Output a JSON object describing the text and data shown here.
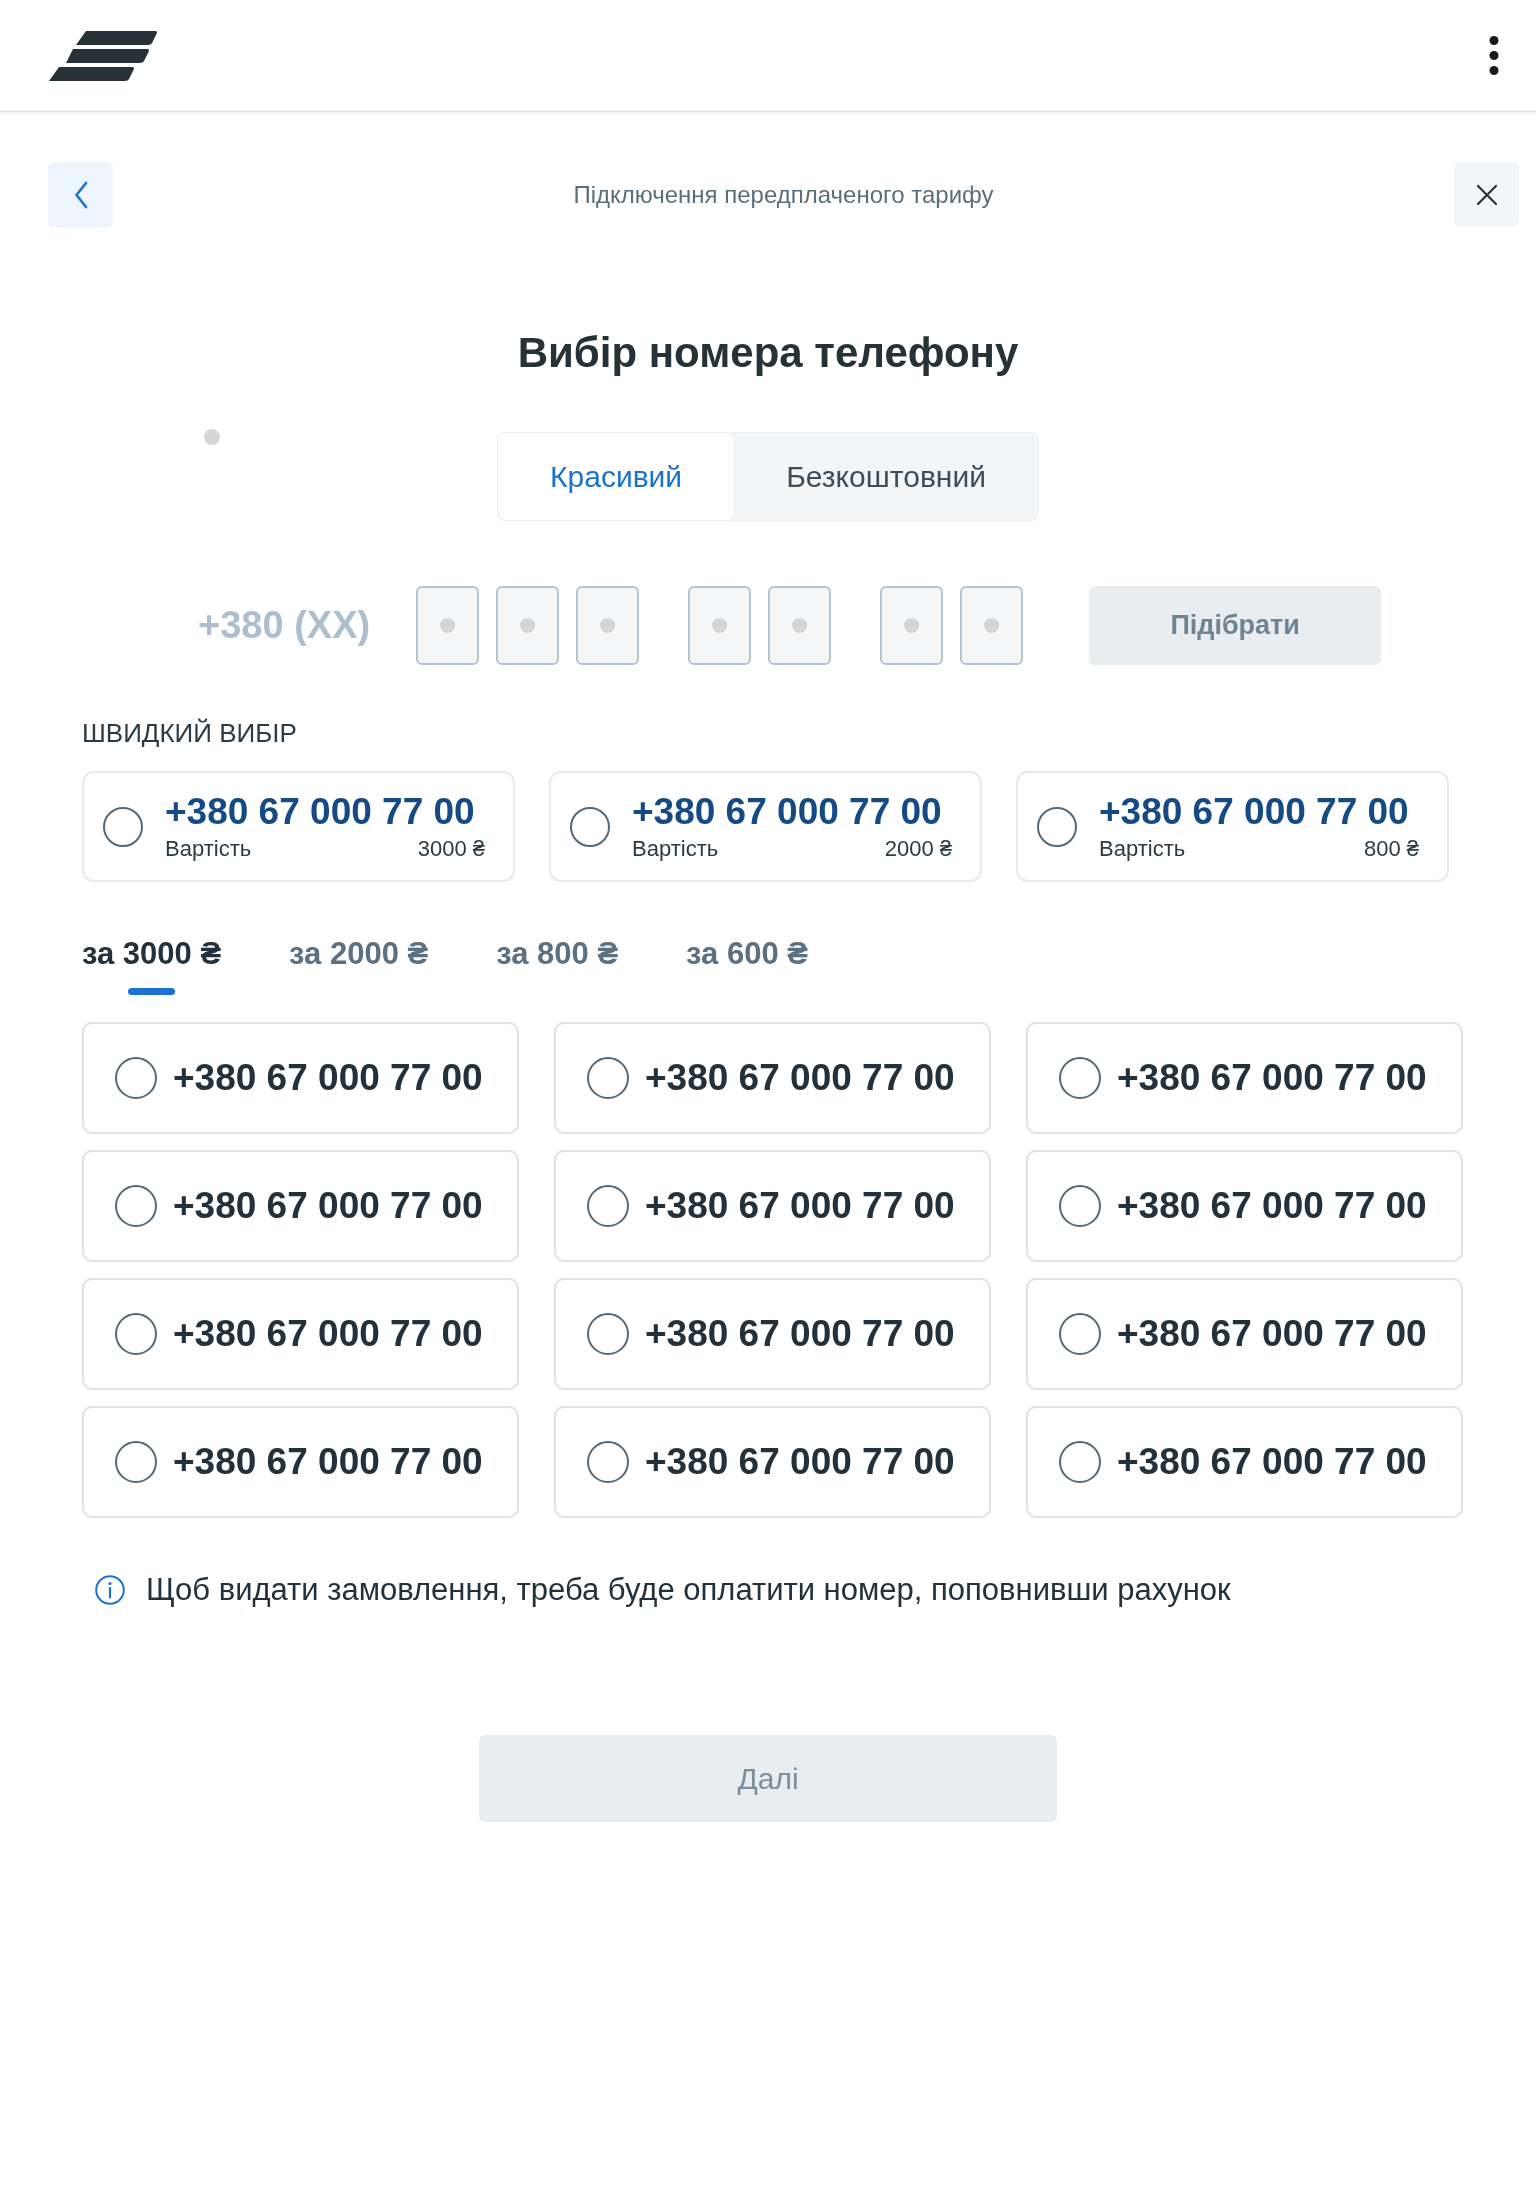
{
  "page_header": {
    "title": "Підключення передплаченого тарифу"
  },
  "heading": "Вибір номера телефону",
  "number_type_tabs": [
    {
      "label": "Красивий",
      "selected": true
    },
    {
      "label": "Безкоштовний",
      "selected": false
    }
  ],
  "number_picker": {
    "prefix": "+380 (XX)",
    "digit_groups": [
      {
        "fields": [
          {
            "filled": false
          },
          {
            "filled": false
          },
          {
            "filled": false
          }
        ]
      },
      {
        "fields": [
          {
            "filled": false
          },
          {
            "filled": false
          }
        ]
      },
      {
        "fields": [
          {
            "filled": false
          },
          {
            "filled": false
          }
        ]
      }
    ],
    "button": {
      "label": "Підібрати",
      "disabled": true
    }
  },
  "quick_choice": {
    "title": "ШВИДКИЙ ВИБІР",
    "options": [
      {
        "number": "+380 67 000 77 00",
        "cost_label": "Вартість",
        "price": "3000 ₴",
        "selected": false
      },
      {
        "number": "+380 67 000 77 00",
        "cost_label": "Вартість",
        "price": "2000 ₴",
        "selected": false
      },
      {
        "number": "+380 67 000 77 00",
        "cost_label": "Вартість",
        "price": "800 ₴",
        "selected": false
      }
    ]
  },
  "price_tabs": [
    {
      "label": "за 3000 ₴",
      "selected": true
    },
    {
      "label": "за 2000 ₴",
      "selected": false
    },
    {
      "label": "за 800 ₴",
      "selected": false
    },
    {
      "label": "за 600 ₴",
      "selected": false
    }
  ],
  "numbers": [
    {
      "number": "+380 67 000 77 00",
      "selected": false
    },
    {
      "number": "+380 67 000 77 00",
      "selected": false
    },
    {
      "number": "+380 67 000 77 00",
      "selected": false
    },
    {
      "number": "+380 67 000 77 00",
      "selected": false
    },
    {
      "number": "+380 67 000 77 00",
      "selected": false
    },
    {
      "number": "+380 67 000 77 00",
      "selected": false
    },
    {
      "number": "+380 67 000 77 00",
      "selected": false
    },
    {
      "number": "+380 67 000 77 00",
      "selected": false
    },
    {
      "number": "+380 67 000 77 00",
      "selected": false
    },
    {
      "number": "+380 67 000 77 00",
      "selected": false
    },
    {
      "number": "+380 67 000 77 00",
      "selected": false
    },
    {
      "number": "+380 67 000 77 00",
      "selected": false
    }
  ],
  "info": {
    "text": "Щоб видати замовлення, треба буде оплатити номер, поповнивши рахунок"
  },
  "next_button": {
    "label": "Далі",
    "disabled": true
  }
}
